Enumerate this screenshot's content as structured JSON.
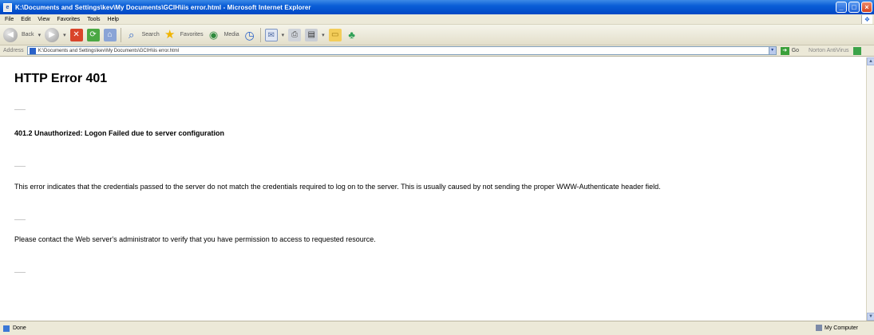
{
  "window": {
    "title": "K:\\Documents and Settings\\kev\\My Documents\\GCIH\\iis error.html - Microsoft Internet Explorer",
    "min_label": "_",
    "max_label": "□",
    "close_label": "×"
  },
  "menu": [
    "File",
    "Edit",
    "View",
    "Favorites",
    "Tools",
    "Help"
  ],
  "toolbar": {
    "back_label": "Back",
    "search_label": "Search",
    "favorites_label": "Favorites",
    "media_label": "Media"
  },
  "address": {
    "label": "Address",
    "url": "K:\\Documents and Settings\\kev\\My Documents\\GCIH\\iis error.html",
    "go_label": "Go",
    "links_label": "Norton AntiVirus"
  },
  "page": {
    "title": "HTTP Error 401",
    "subtitle": "401.2 Unauthorized: Logon Failed due to server configuration",
    "description": "This error indicates that the credentials passed to the server do not match the credentials required to log on to the server. This is usually caused by not sending the proper WWW-Authenticate header field.",
    "contact": "Please contact the Web server's administrator to verify that you have permission to access to requested resource."
  },
  "status": {
    "text": "Done",
    "zone": "My Computer"
  }
}
